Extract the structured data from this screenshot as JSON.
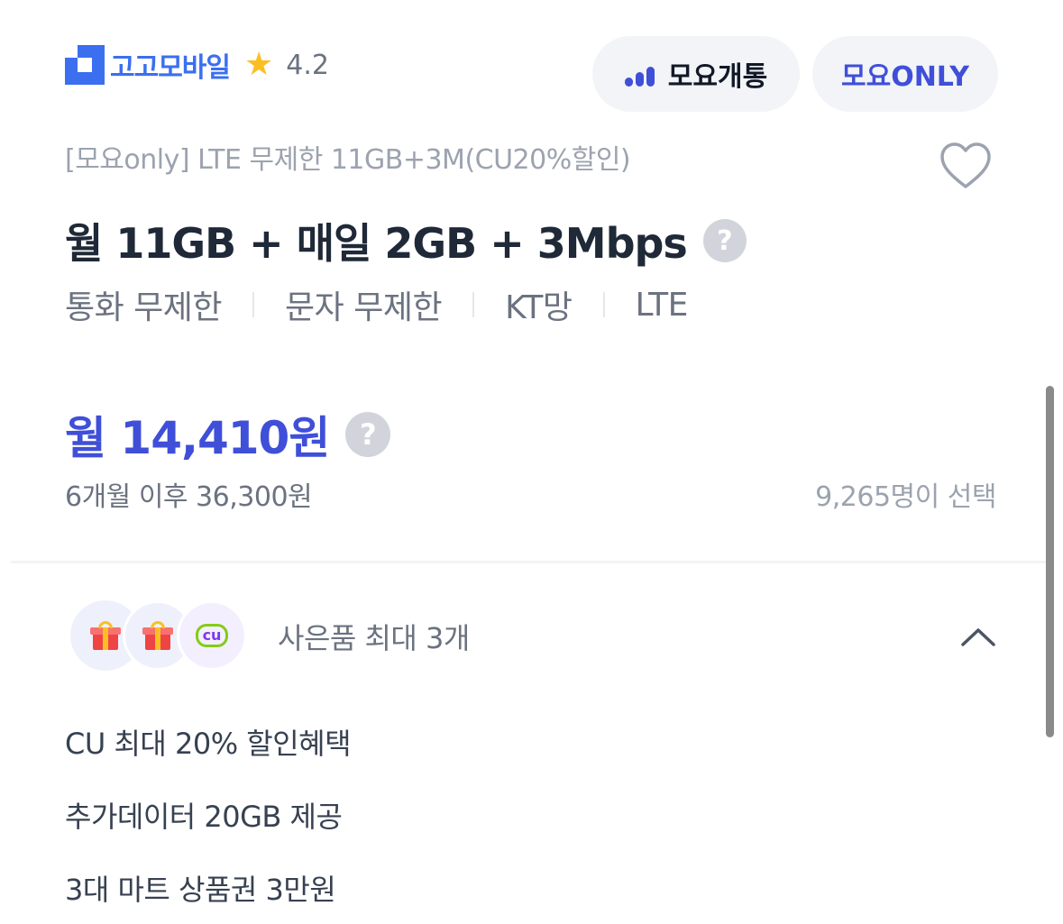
{
  "header": {
    "brand": "고고모바일",
    "rating": "4.2",
    "moyo_button": "모요개통",
    "only_button": "모요ONLY"
  },
  "plan": {
    "name": "[모요only] LTE 무제한 11GB+3M(CU20%할인)",
    "title": "월 11GB + 매일 2GB + 3Mbps",
    "help_glyph": "?",
    "features": [
      "통화 무제한",
      "문자 무제한",
      "KT망",
      "LTE"
    ]
  },
  "price": {
    "monthly": "월 14,410원",
    "after": "6개월 이후 36,300원",
    "chosen": "9,265명이 선택"
  },
  "gifts": {
    "cu_badge": "cu",
    "label": "사은품 최대 3개",
    "items": [
      "CU 최대 20% 할인혜택",
      "추가데이터 20GB 제공",
      "3대 마트 상품권 3만원"
    ]
  },
  "colors": {
    "brand_blue": "#3b6ff0",
    "accent": "#3f4fd8",
    "star": "#fbbf24"
  }
}
